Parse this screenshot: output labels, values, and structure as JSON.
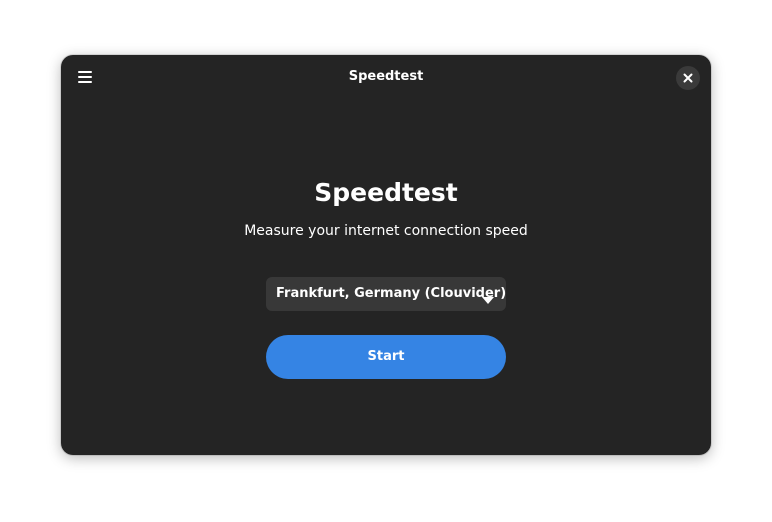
{
  "window": {
    "title": "Speedtest"
  },
  "main": {
    "heading": "Speedtest",
    "subtitle": "Measure your internet connection speed",
    "server": {
      "selected": "Frankfurt, Germany (Clouvider)"
    },
    "start_label": "Start"
  },
  "icons": {
    "menu": "hamburger-menu-icon",
    "close": "close-icon",
    "dropdown": "chevron-down-icon"
  },
  "colors": {
    "window_bg": "#242424",
    "accent": "#3584e4",
    "dropdown_bg": "#383838"
  }
}
